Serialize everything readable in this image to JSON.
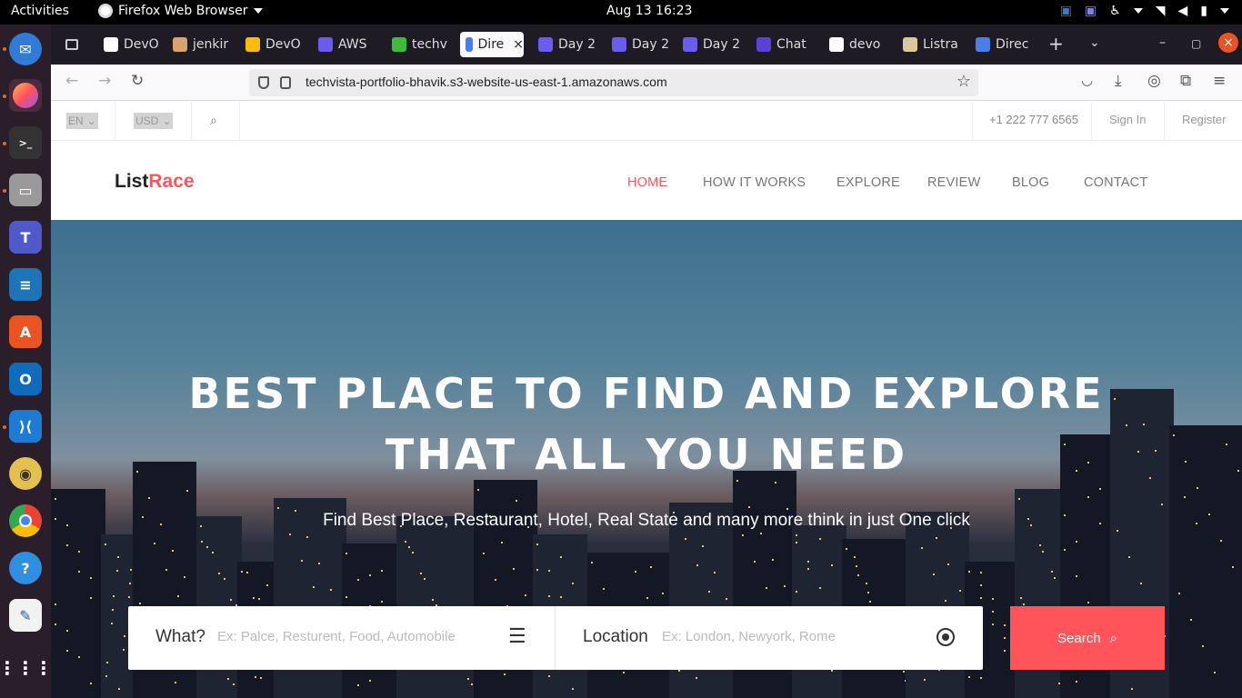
{
  "system": {
    "activities": "Activities",
    "app_name": "Firefox Web Browser",
    "clock": "Aug 13  16:23"
  },
  "browser": {
    "tabs": [
      {
        "label": "DevO",
        "icon_color": "#ffffff",
        "icon": "github-icon"
      },
      {
        "label": "jenkir",
        "icon_color": "#d9a36c",
        "icon": "jenkins-icon"
      },
      {
        "label": "DevO",
        "icon_color": "#fbbc04",
        "icon": "drive-icon"
      },
      {
        "label": "AWS",
        "icon_color": "#6b5cf0",
        "icon": "doc-icon"
      },
      {
        "label": "techv",
        "icon_color": "#3dbb3d",
        "icon": "terminal-icon"
      },
      {
        "label": "Dire",
        "icon_color": "#4a7de8",
        "icon": "site-icon",
        "active": true
      },
      {
        "label": "Day 2",
        "icon_color": "#6b5cf0",
        "icon": "doc-icon"
      },
      {
        "label": "Day 2",
        "icon_color": "#6b5cf0",
        "icon": "doc-icon"
      },
      {
        "label": "Day 2",
        "icon_color": "#6b5cf0",
        "icon": "doc-icon"
      },
      {
        "label": "Chat",
        "icon_color": "#5b43d6",
        "icon": "teams-icon"
      },
      {
        "label": "devo",
        "icon_color": "#ffffff",
        "icon": "github-icon"
      },
      {
        "label": "Listra",
        "icon_color": "#d8c89a",
        "icon": "site-icon"
      },
      {
        "label": "Direc",
        "icon_color": "#4a7de8",
        "icon": "site-icon"
      }
    ],
    "url": "techvista-portfolio-bhavik.s3-website-us-east-1.amazonaws.com"
  },
  "page": {
    "util": {
      "lang": "EN",
      "currency": "USD",
      "phone": "+1 222 777 6565",
      "signin": "Sign In",
      "register": "Register"
    },
    "logo": {
      "part1": "List",
      "part2": "Race"
    },
    "nav": [
      "HOME",
      "HOW IT WORKS",
      "EXPLORE",
      "REVIEW",
      "BLOG",
      "CONTACT"
    ],
    "hero": {
      "title_line1": "BEST PLACE TO FIND AND EXPLORE",
      "title_line2": "THAT ALL YOU NEED",
      "subtitle": "Find Best Place, Restaurant, Hotel, Real State and many more think in just One click"
    },
    "search": {
      "what_label": "What?",
      "what_placeholder": "Ex: Palce, Resturent, Food, Automobile",
      "location_label": "Location",
      "location_placeholder": "Ex: London, Newyork, Rome",
      "button": "Search"
    },
    "accent_color": "#ff545a"
  }
}
